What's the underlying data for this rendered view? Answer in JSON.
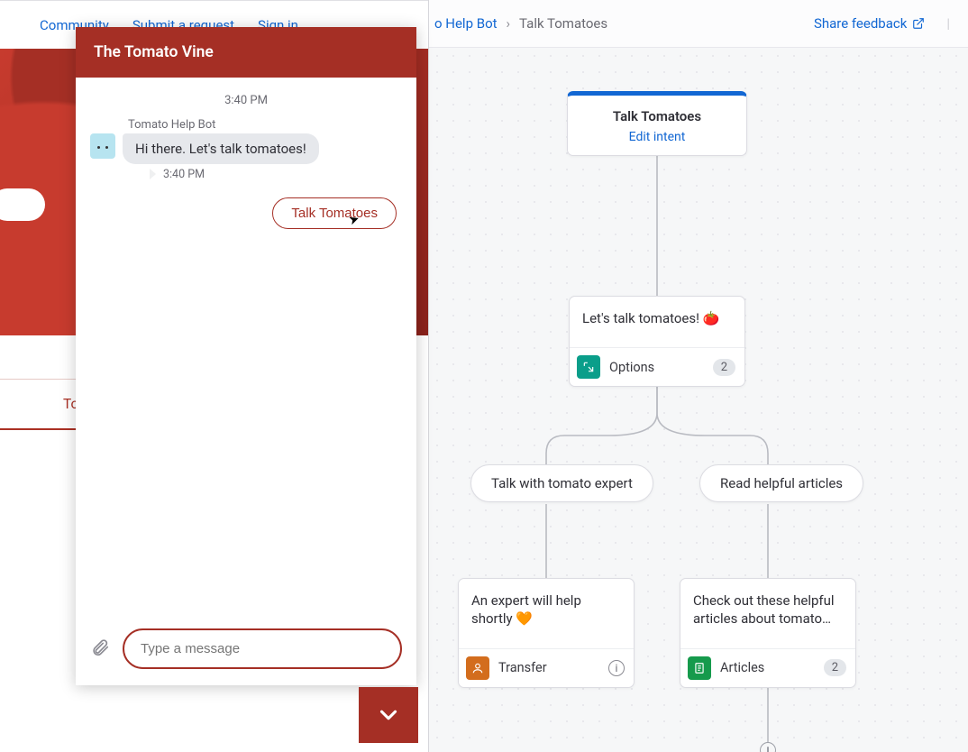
{
  "nav": {
    "community": "Community",
    "submit": "Submit a request",
    "signin": "Sign in"
  },
  "left_tab": {
    "label": "To"
  },
  "chat": {
    "title": "The Tomato Vine",
    "timestamp_top": "3:40 PM",
    "sender": "Tomato Help Bot",
    "message_1": "Hi there. Let's talk tomatoes!",
    "timestamp_msg": "3:40 PM",
    "quick_reply": "Talk Tomatoes",
    "input_placeholder": "Type a message"
  },
  "builder": {
    "breadcrumb": {
      "bot": "o Help Bot",
      "current": "Talk Tomatoes"
    },
    "share_feedback": "Share feedback",
    "start": {
      "title": "Talk Tomatoes",
      "edit": "Edit intent"
    },
    "step_options": {
      "msg": "Let's talk tomatoes! 🍅",
      "type": "Options",
      "count": "2"
    },
    "option_a": "Talk with tomato expert",
    "option_b": "Read helpful articles",
    "step_transfer": {
      "msg": "An expert will help shortly 🧡",
      "type": "Transfer"
    },
    "step_articles": {
      "msg": "Check out these helpful articles about tomato…",
      "type": "Articles",
      "count": "2"
    }
  }
}
